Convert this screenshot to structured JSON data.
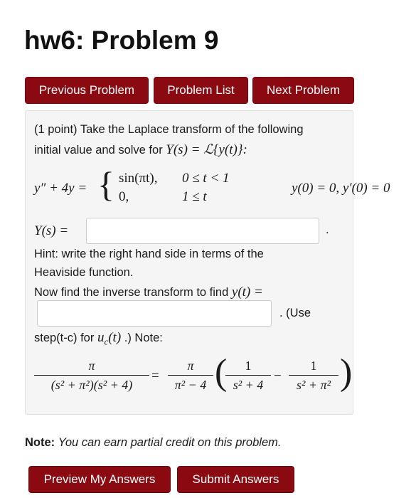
{
  "page": {
    "title": "hw6: Problem 9"
  },
  "nav": {
    "previous": "Previous Problem",
    "list": "Problem List",
    "next": "Next Problem"
  },
  "problem": {
    "intro_line1": "(1 point) Take the Laplace transform of the following",
    "intro_line2": "initial value and solve for",
    "intro_math": "Y(s) = ℒ{y(t)}:",
    "ode_lhs": "y″ + 4y =",
    "case1_value": "sin(πt),",
    "case1_cond": "0 ≤ t < 1",
    "case2_value": "0,",
    "case2_cond": "1 ≤ t",
    "initial_conditions": "y(0) = 0,  y′(0) = 0",
    "Y_label": "Y(s) =",
    "Y_input_value": "",
    "period_after_Y": ".",
    "hint_line1": "Hint: write the right hand side in terms of the",
    "hint_line2": "Heaviside function.",
    "inverse_text": "Now find the inverse transform to find",
    "inverse_math": "y(t) =",
    "y_input_value": "",
    "use_text": ". (Use",
    "step_text": "step(t-c) for",
    "step_math": "u",
    "step_sub": "c",
    "step_math_tail": "(t)",
    "note_text": ".) Note:",
    "eq_lhs_num": "π",
    "eq_lhs_den": "(s² + π²)(s² + 4)",
    "eq_equals": "=",
    "eq_coef_num": "π",
    "eq_coef_den": "π² − 4",
    "eq_t1_num": "1",
    "eq_t1_den": "s² + 4",
    "eq_minus": "−",
    "eq_t2_num": "1",
    "eq_t2_den": "s² + π²"
  },
  "footer": {
    "note_label": "Note:",
    "note_text": "You can earn partial credit on this problem.",
    "preview": "Preview My Answers",
    "submit": "Submit Answers"
  }
}
